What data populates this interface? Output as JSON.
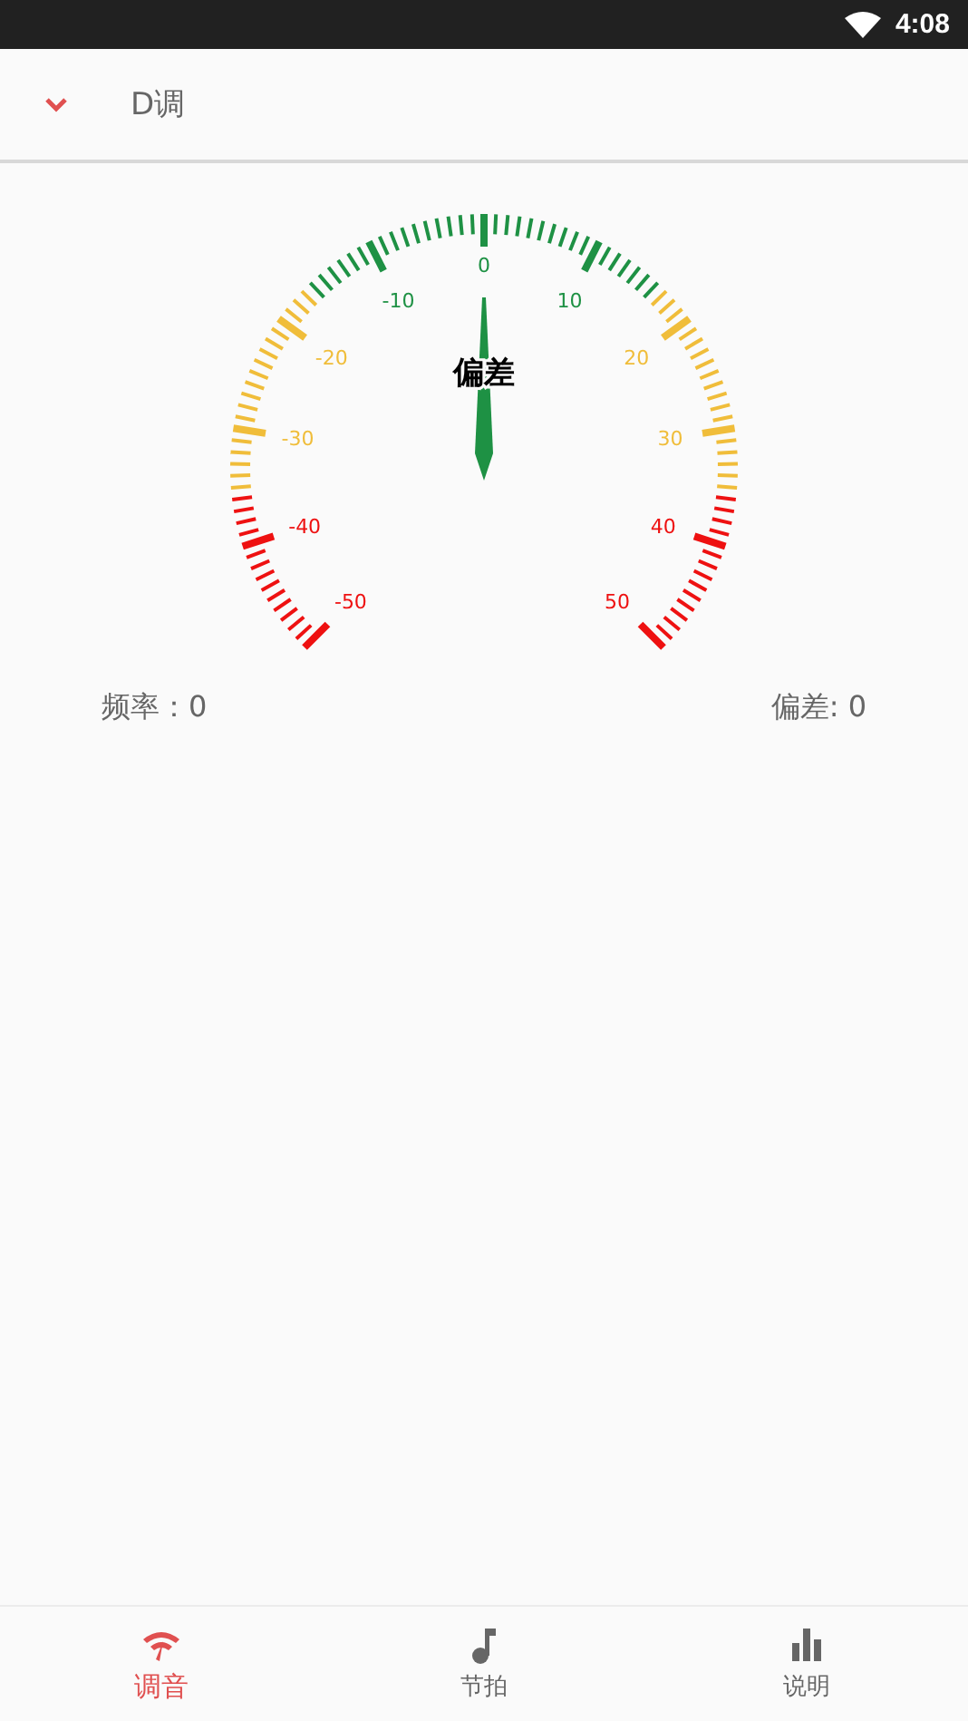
{
  "status_bar": {
    "time": "4:08"
  },
  "toolbar": {
    "title": "D调"
  },
  "gauge": {
    "title": "偏差",
    "level": 0.5,
    "labels": [
      "-50",
      "-40",
      "-30",
      "-20",
      "-10",
      "0",
      "10",
      "20",
      "30",
      "40",
      "50"
    ]
  },
  "readouts": [
    {
      "label": "频率：0"
    },
    {
      "label": "偏差: 0"
    }
  ],
  "tabs": [
    {
      "label": "调音",
      "kind": "tuner",
      "selected": true
    },
    {
      "label": "节拍",
      "kind": "note",
      "selected": false
    },
    {
      "label": "说明",
      "kind": "bars",
      "selected": false
    }
  ]
}
